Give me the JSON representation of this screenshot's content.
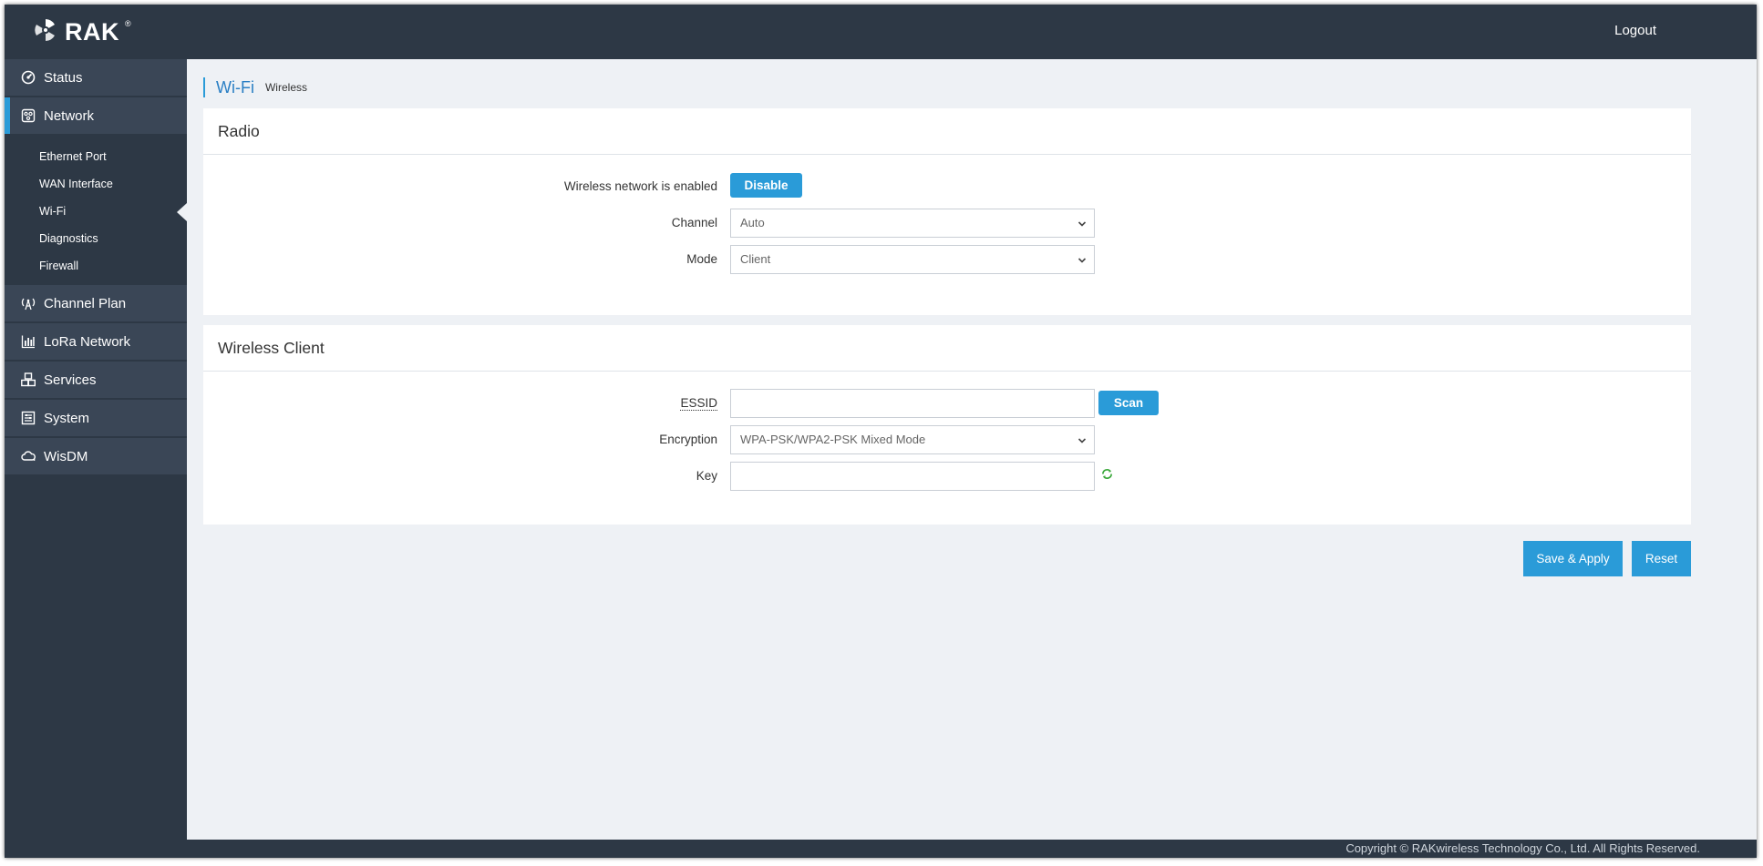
{
  "header": {
    "brand": "RAK",
    "brand_mark": "®",
    "logout": "Logout"
  },
  "sidebar": {
    "items": [
      {
        "label": "Status",
        "icon": "gauge-icon"
      },
      {
        "label": "Network",
        "icon": "network-icon"
      },
      {
        "label": "Channel Plan",
        "icon": "antenna-icon"
      },
      {
        "label": "LoRa Network",
        "icon": "bar-chart-icon"
      },
      {
        "label": "Services",
        "icon": "cubes-icon"
      },
      {
        "label": "System",
        "icon": "system-icon"
      },
      {
        "label": "WisDM",
        "icon": "cloud-icon"
      }
    ],
    "network_sub": [
      "Ethernet Port",
      "WAN Interface",
      "Wi-Fi",
      "Diagnostics",
      "Firewall"
    ]
  },
  "breadcrumb": {
    "title": "Wi-Fi",
    "sub": "Wireless"
  },
  "radio": {
    "heading": "Radio",
    "status_label": "Wireless network is enabled",
    "toggle_button": "Disable",
    "channel_label": "Channel",
    "channel_value": "Auto",
    "mode_label": "Mode",
    "mode_value": "Client"
  },
  "client": {
    "heading": "Wireless Client",
    "essid_label": "ESSID",
    "essid_value": "",
    "scan_button": "Scan",
    "encryption_label": "Encryption",
    "encryption_value": "WPA-PSK/WPA2-PSK Mixed Mode",
    "key_label": "Key",
    "key_value": ""
  },
  "actions": {
    "save": "Save & Apply",
    "reset": "Reset"
  },
  "footer": {
    "copyright": "Copyright © RAKwireless Technology Co., Ltd. All Rights Reserved."
  },
  "colors": {
    "accent": "#2a9bd8",
    "nav_bg": "#2d3845",
    "content_bg": "#eef1f5"
  }
}
